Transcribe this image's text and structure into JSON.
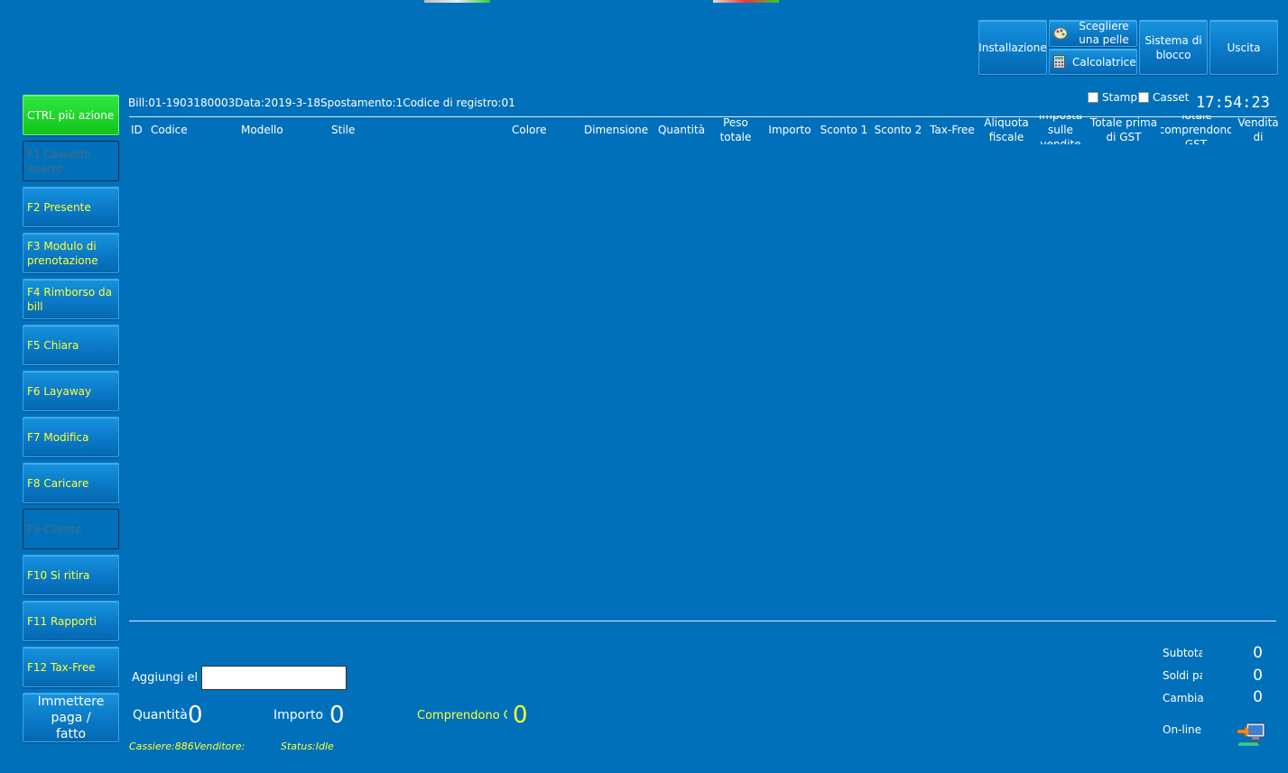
{
  "window": {
    "bill_info": "Bill:01-1903180003Data:2019-3-18Spostamento:1Codice di registro:01",
    "clock": "17:54:23"
  },
  "toolbar": {
    "installazione": "Installazione",
    "scegliere_pelle": "Scegliere una pelle",
    "calcolatrice": "Calcolatrice",
    "sistema_blocco": "Sistema di blocco",
    "uscita": "Uscita"
  },
  "options": {
    "stamp": "Stamp",
    "casset": "Casset"
  },
  "sidebar": {
    "items": [
      {
        "label": "CTRL più azione"
      },
      {
        "label": "F1 Cassetto aperto"
      },
      {
        "label": "F2 Presente"
      },
      {
        "label": "F3 Modulo di prenotazione"
      },
      {
        "label": "F4 Rimborso da bill"
      },
      {
        "label": "F5 Chiara"
      },
      {
        "label": "F6 Layaway"
      },
      {
        "label": "F7 Modifica"
      },
      {
        "label": "F8 Caricare"
      },
      {
        "label": "F9 Cliente"
      },
      {
        "label": "F10 Si ritira"
      },
      {
        "label": "F11 Rapporti"
      },
      {
        "label": "F12 Tax-Free"
      },
      {
        "label": "Immettere paga / fatto"
      }
    ]
  },
  "table": {
    "columns": [
      "ID",
      "Codice",
      "Modello",
      "Stile",
      "Colore",
      "Dimensione",
      "Quantità",
      "Peso totale",
      "Importo",
      "Sconto 1",
      "Sconto 2",
      "Tax-Free",
      "Aliquota fiscale",
      "Imposta sulle vendite",
      "Totale prima di GST",
      "Totale comprendono GST",
      "Vendita di"
    ]
  },
  "entry": {
    "aggiungi_label": "Aggiungi ele",
    "aggiungi_value": "",
    "quantita_label": "Quantità",
    "quantita_value": "0",
    "importo_label": "Importo",
    "importo_value": "0",
    "comprendono_label": "Comprendono G",
    "comprendono_value": "0"
  },
  "status": {
    "cassiere": "Cassiere:886Venditore:",
    "status": "Status:Idle"
  },
  "summary": {
    "subtotale_label": "Subtotale",
    "subtotale_value": "0",
    "soldi_label": "Soldi pagati",
    "soldi_value": "0",
    "cambia_label": "Cambia",
    "cambia_value": "0",
    "online_label": "On-line"
  },
  "colors": {
    "background": "#0070bb",
    "accent_text": "#ffff33",
    "active_button": "#22dd2a"
  }
}
